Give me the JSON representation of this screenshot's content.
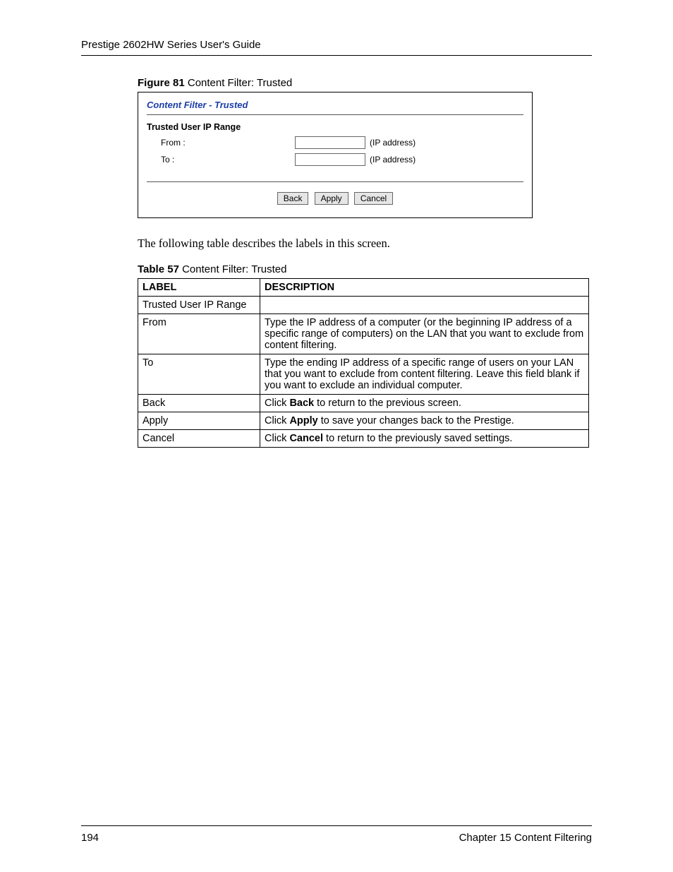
{
  "header": {
    "title": "Prestige 2602HW Series User's Guide"
  },
  "figure": {
    "label_bold": "Figure 81",
    "label_rest": "   Content Filter: Trusted"
  },
  "panel": {
    "title": "Content Filter - Trusted",
    "section": "Trusted User IP Range",
    "from_label": "From :",
    "to_label": "To :",
    "hint": "(IP address)",
    "buttons": {
      "back": "Back",
      "apply": "Apply",
      "cancel": "Cancel"
    }
  },
  "body_text": "The following table describes the labels in this screen.",
  "table_caption": {
    "bold": "Table 57",
    "rest": "   Content Filter: Trusted"
  },
  "table": {
    "headers": {
      "label": "LABEL",
      "description": "DESCRIPTION"
    },
    "rows": [
      {
        "label": "Trusted User IP Range",
        "desc": ""
      },
      {
        "label": "From",
        "desc": "Type the IP address of a computer (or the beginning IP address of a specific range of computers) on the LAN that you want to exclude from content filtering."
      },
      {
        "label": "To",
        "desc": "Type the ending IP address of a specific range of users on your LAN that you want to exclude from content filtering. Leave this field blank if you want to exclude an individual computer."
      },
      {
        "label": "Back",
        "desc_pre": "Click ",
        "desc_bold": "Back",
        "desc_post": " to return to the previous screen."
      },
      {
        "label": "Apply",
        "desc_pre": "Click ",
        "desc_bold": "Apply",
        "desc_post": " to save your changes back to the Prestige."
      },
      {
        "label": "Cancel",
        "desc_pre": "Click ",
        "desc_bold": "Cancel",
        "desc_post": " to return to the previously saved settings."
      }
    ]
  },
  "footer": {
    "page": "194",
    "chapter": "Chapter 15 Content Filtering"
  }
}
